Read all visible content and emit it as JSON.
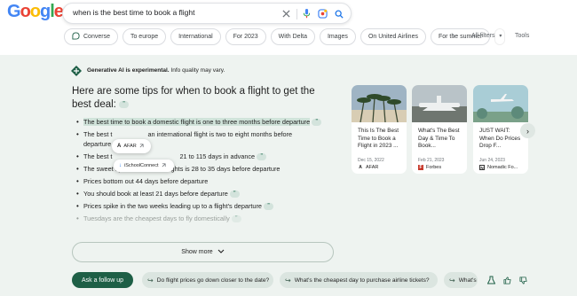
{
  "search": {
    "query": "when is the best time to book a flight"
  },
  "logo": {
    "letters": [
      "G",
      "o",
      "o",
      "g",
      "l",
      "e"
    ]
  },
  "filters": {
    "chips": [
      "Converse",
      "To europe",
      "International",
      "For 2023",
      "With Delta",
      "Images",
      "On United Airlines",
      "For the summer"
    ],
    "all_filters": "All filters",
    "tools": "Tools"
  },
  "ai_overview": {
    "badge_bold": "Generative AI is experimental.",
    "badge_rest": " Info quality may vary.",
    "headline": "Here are some tips for when to book a flight to get the best deal:",
    "tips": [
      "The best time to book a domestic flight is one to three months before departure",
      "The best time to book an international flight is two to eight months before departure",
      "The best time is 21 to 115 days in advance",
      "The sweet spot for domestic flights is 28 to 35 days before departure",
      "Prices bottom out 44 days before departure",
      "You should book at least 21 days before departure",
      "Prices spike in the two weeks leading up to a flight's departure",
      "Tuesdays are the cheapest days to fly domestically"
    ],
    "tip_parts": {
      "t2a": "The best t",
      "t2b": "an international flight is two to eight months before",
      "t2c": "departure",
      "t3a": "The best t",
      "t3b": "21 to 115 days in advance"
    },
    "popover_1": "AFAR",
    "popover_2": "iSchoolConnect",
    "quote_glyph": "”",
    "show_more": "Show more"
  },
  "cards": [
    {
      "title": "This Is The Best Time to Book a Flight in 2023 ...",
      "date": "Dec 15, 2022",
      "source": "AFAR",
      "favicon": "A"
    },
    {
      "title": "What's The Best Day & Time To Book...",
      "date": "Feb 21, 2023",
      "source": "Forbes",
      "favicon": "F"
    },
    {
      "title": "JUST WAIT: When Do Prices Drop F...",
      "date": "Jun 24, 2023",
      "source": "Nomadic Fo...",
      "favicon": "N"
    }
  ],
  "followups": {
    "ask_button": "Ask a follow up",
    "suggestions": [
      "Do flight prices go down closer to the date?",
      "What's the cheapest day to purchase airline tickets?",
      "What's"
    ]
  },
  "colors": {
    "panel_bg": "#eef3f0",
    "accent_green": "#1e5f46",
    "highlight": "#d0e3da"
  }
}
